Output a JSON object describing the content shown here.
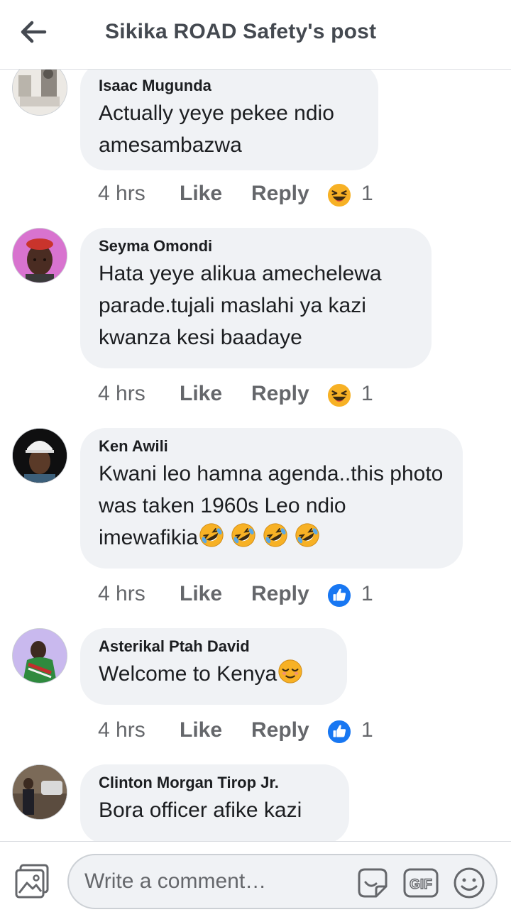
{
  "header": {
    "title": "Sikika ROAD Safety's post"
  },
  "comments": [
    {
      "author": "Isaac Mugunda",
      "text": "Actually yeye pekee ndio amesambazwa",
      "time": "4 hrs",
      "like_label": "Like",
      "reply_label": "Reply",
      "reaction_icon": "laughing-face-icon",
      "reaction_count": "1"
    },
    {
      "author": "Seyma Omondi",
      "text": "Hata yeye alikua amechelewa parade.tujali maslahi ya kazi kwanza kesi baadaye",
      "time": "4 hrs",
      "like_label": "Like",
      "reply_label": "Reply",
      "reaction_icon": "laughing-face-icon",
      "reaction_count": "1"
    },
    {
      "author": "Ken Awili",
      "text": "Kwani leo hamna agenda..this photo was taken 1960s Leo ndio imewafikia",
      "inline_emoji": "rolling-on-floor-laughing-icon",
      "time": "4 hrs",
      "like_label": "Like",
      "reply_label": "Reply",
      "reaction_icon": "thumbs-up-icon",
      "reaction_count": "1"
    },
    {
      "author": "Asterikal Ptah David",
      "text": "Welcome to Kenya",
      "inline_emoji": "relieved-face-icon",
      "time": "4 hrs",
      "like_label": "Like",
      "reply_label": "Reply",
      "reaction_icon": "thumbs-up-icon",
      "reaction_count": "1"
    },
    {
      "author": "Clinton Morgan Tirop Jr.",
      "text": "Bora officer afike kazi"
    }
  ],
  "composer": {
    "placeholder": "Write a comment…"
  },
  "colors": {
    "accent": "#1877f2",
    "bubble": "#f0f2f5",
    "muted": "#65676b",
    "laugh": "#f7b125"
  }
}
